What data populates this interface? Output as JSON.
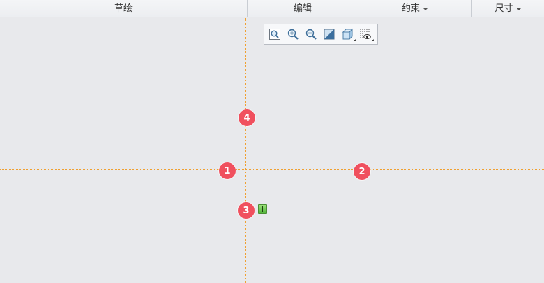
{
  "ribbon": {
    "groups": [
      {
        "label": "草绘"
      },
      {
        "label": "编辑"
      },
      {
        "label": "约束"
      },
      {
        "label": "尺寸"
      }
    ]
  },
  "toolbar": {
    "tools": [
      {
        "icon": "zoom-fit-icon"
      },
      {
        "icon": "zoom-in-icon"
      },
      {
        "icon": "zoom-out-icon"
      },
      {
        "icon": "repaint-icon"
      },
      {
        "icon": "display-style-icon"
      },
      {
        "icon": "sketch-display-icon"
      }
    ]
  },
  "markers": [
    "1",
    "2",
    "3",
    "4"
  ],
  "colors": {
    "marker": "#f0505e",
    "axis": "#f0a030",
    "canvas": "#e8e9ec"
  }
}
